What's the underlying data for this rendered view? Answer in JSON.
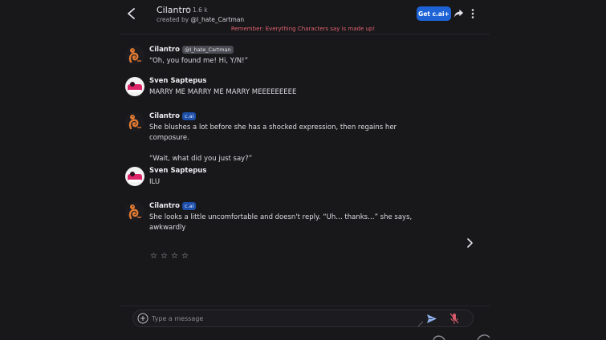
{
  "header": {
    "character_name": "Cilantro",
    "interactions": "1.6 k",
    "creator_prefix": "created by",
    "creator_handle": "@I_hate_Cartman",
    "get_cai_label": "Get c.ai+",
    "disclaimer": "Remember: Everything Characters say is made up!",
    "icons": {
      "back": "chevron-left-icon",
      "stats": "chat-bubble-icon",
      "share": "share-arrow-icon",
      "more": "more-vertical-icon"
    }
  },
  "messages": [
    {
      "author": "Cilantro",
      "badge": "@I_hate_Cartman",
      "badge_type": "creator",
      "avatar": "cilantro-avatar",
      "paragraphs": [
        "“Oh, you found me! Hi, Y/N!”"
      ]
    },
    {
      "author": "Sven Saptepus",
      "badge": "",
      "badge_type": "none",
      "avatar": "user-avatar",
      "paragraphs": [
        "MARRY ME MARRY ME MARRY MEEEEEEEEE"
      ]
    },
    {
      "author": "Cilantro",
      "badge": "c.ai",
      "badge_type": "cai",
      "avatar": "cilantro-avatar",
      "paragraphs": [
        "She blushes a lot before she has a shocked expression, then regains her composure.",
        "“Wait, what did you just say?”"
      ]
    },
    {
      "author": "Sven Saptepus",
      "badge": "",
      "badge_type": "none",
      "avatar": "user-avatar",
      "paragraphs": [
        "ILU"
      ]
    },
    {
      "author": "Cilantro",
      "badge": "c.ai",
      "badge_type": "cai",
      "avatar": "cilantro-avatar",
      "paragraphs": [
        "She looks a little uncomfortable and doesn't reply. “Uh… thanks…” she says, awkwardly"
      ]
    }
  ],
  "rating": {
    "stars": [
      "☆",
      "☆",
      "☆",
      "☆"
    ],
    "value": 0
  },
  "composer": {
    "placeholder": "Type a message",
    "value": "",
    "icons": {
      "add": "plus-circle-icon",
      "send": "send-icon",
      "mic": "mic-off-icon"
    }
  },
  "colors": {
    "background": "#18181b",
    "accent": "#1d63d6",
    "disclaimer": "#e0626e",
    "cai_badge": "#1e4fa8"
  }
}
